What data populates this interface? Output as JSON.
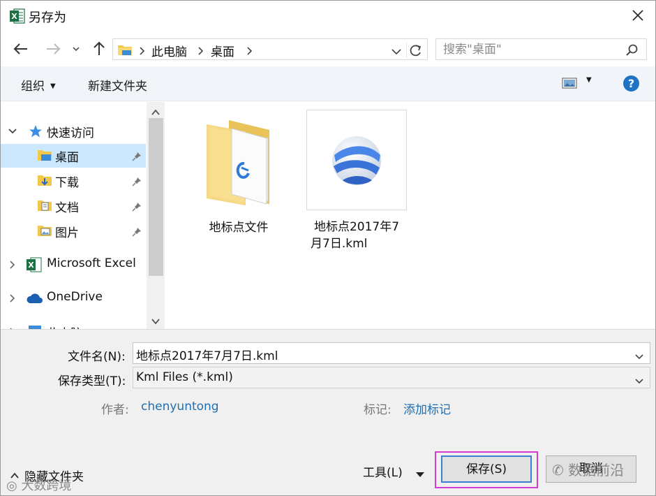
{
  "window": {
    "title": "另存为",
    "app_icon": "excel-icon",
    "close_icon": "close-icon"
  },
  "nav": {
    "back_icon": "back-arrow-icon",
    "forward_icon": "forward-arrow-icon",
    "recent_icon": "chevron-down-icon",
    "up_icon": "up-arrow-icon",
    "breadcrumb": [
      "此电脑",
      "桌面"
    ],
    "search_placeholder": "搜索\"桌面\""
  },
  "toolbar": {
    "organize_label": "组织",
    "new_folder_label": "新建文件夹",
    "view_icon": "view-options-icon",
    "help_icon": "help-icon"
  },
  "sidebar": {
    "quick_access_label": "快速访问",
    "items": [
      {
        "label": "桌面",
        "icon": "desktop-folder-icon",
        "pinned": true,
        "selected": true
      },
      {
        "label": "下载",
        "icon": "download-folder-icon",
        "pinned": true,
        "selected": false
      },
      {
        "label": "文档",
        "icon": "documents-folder-icon",
        "pinned": true,
        "selected": false
      },
      {
        "label": "图片",
        "icon": "pictures-folder-icon",
        "pinned": true,
        "selected": false
      }
    ],
    "excel_label": "Microsoft Excel",
    "onedrive_label": "OneDrive",
    "thispc_label": "此电脑"
  },
  "files": [
    {
      "name": "地标点文件",
      "type": "folder"
    },
    {
      "name_line1": "地标点2017年7",
      "name_line2": "月7日.kml",
      "type": "kml"
    }
  ],
  "form": {
    "filename_label": "文件名(N):",
    "filename_value": "地标点2017年7月7日.kml",
    "filetype_label": "保存类型(T):",
    "filetype_value": "Kml Files (*.kml)",
    "author_label": "作者:",
    "author_value": "chenyuntong",
    "tags_label": "标记:",
    "tags_value": "添加标记"
  },
  "footer": {
    "hide_folders_label": "隐藏文件夹",
    "tools_label": "工具(L)",
    "save_label": "保存(S)",
    "cancel_label": "取消"
  },
  "watermarks": {
    "left": "大数跨境",
    "right": "数据前沿"
  },
  "colors": {
    "selection": "#cce8ff",
    "accent": "#1f6fb5",
    "save_highlight": "#d23cd2"
  }
}
